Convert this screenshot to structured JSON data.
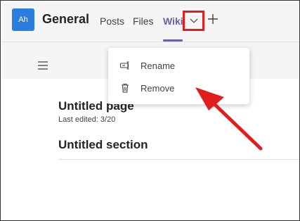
{
  "header": {
    "avatar_initials": "Ah",
    "channel_title": "General",
    "tabs": [
      {
        "label": "Posts"
      },
      {
        "label": "Files"
      },
      {
        "label": "Wiki",
        "active": true
      }
    ],
    "dropdown_icon": "chevron-down-icon",
    "add_icon": "plus-icon"
  },
  "toolbar": {
    "menu_icon": "hamburger-icon"
  },
  "page": {
    "title": "Untitled page",
    "last_edited": "Last edited: 3/20",
    "section_title": "Untitled section"
  },
  "context_menu": {
    "items": [
      {
        "label": "Rename",
        "icon": "rename-icon"
      },
      {
        "label": "Remove",
        "icon": "trash-icon"
      }
    ]
  },
  "colors": {
    "accent": "#6264a7",
    "avatar": "#2b7ee0",
    "annotation": "#e11d1d"
  }
}
